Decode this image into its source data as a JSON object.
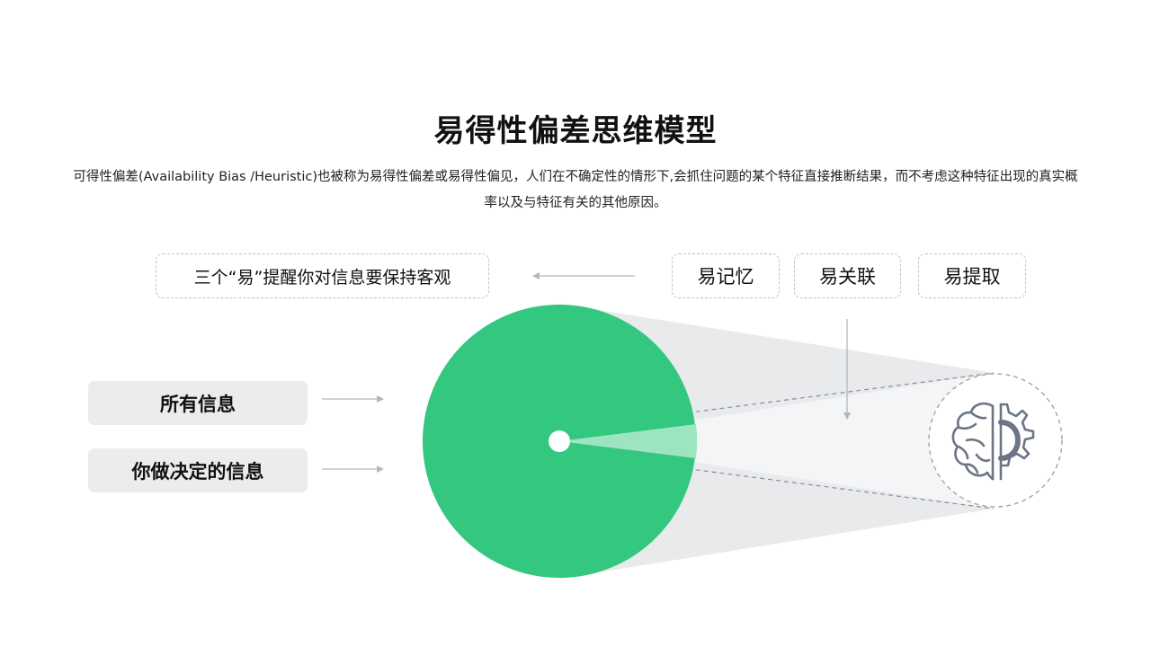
{
  "title": "易得性偏差思维模型",
  "description": "可得性偏差(Availability Bias /Heuristic)也被称为易得性偏差或易得性偏见，人们在不确定性的情形下,会抓住问题的某个特征直接推断结果，而不考虑这种特征出现的真实概率以及与特征有关的其他原因。",
  "reminder_box": "三个“易”提醒你对信息要保持客观",
  "tags": [
    "易记忆",
    "易关联",
    "易提取"
  ],
  "left_labels": {
    "all_info": "所有信息",
    "decision_info": "你做决定的信息"
  },
  "icons": {
    "center": "brain-gear-icon",
    "arrows": "arrow-icon"
  },
  "colors": {
    "circle": "#33c77f",
    "slice": "#9de5c0",
    "cone": "#e9eaeb",
    "beam": "#f4f5f6",
    "icon_stroke": "#6c7585",
    "dashed": "#bfc3c8"
  }
}
